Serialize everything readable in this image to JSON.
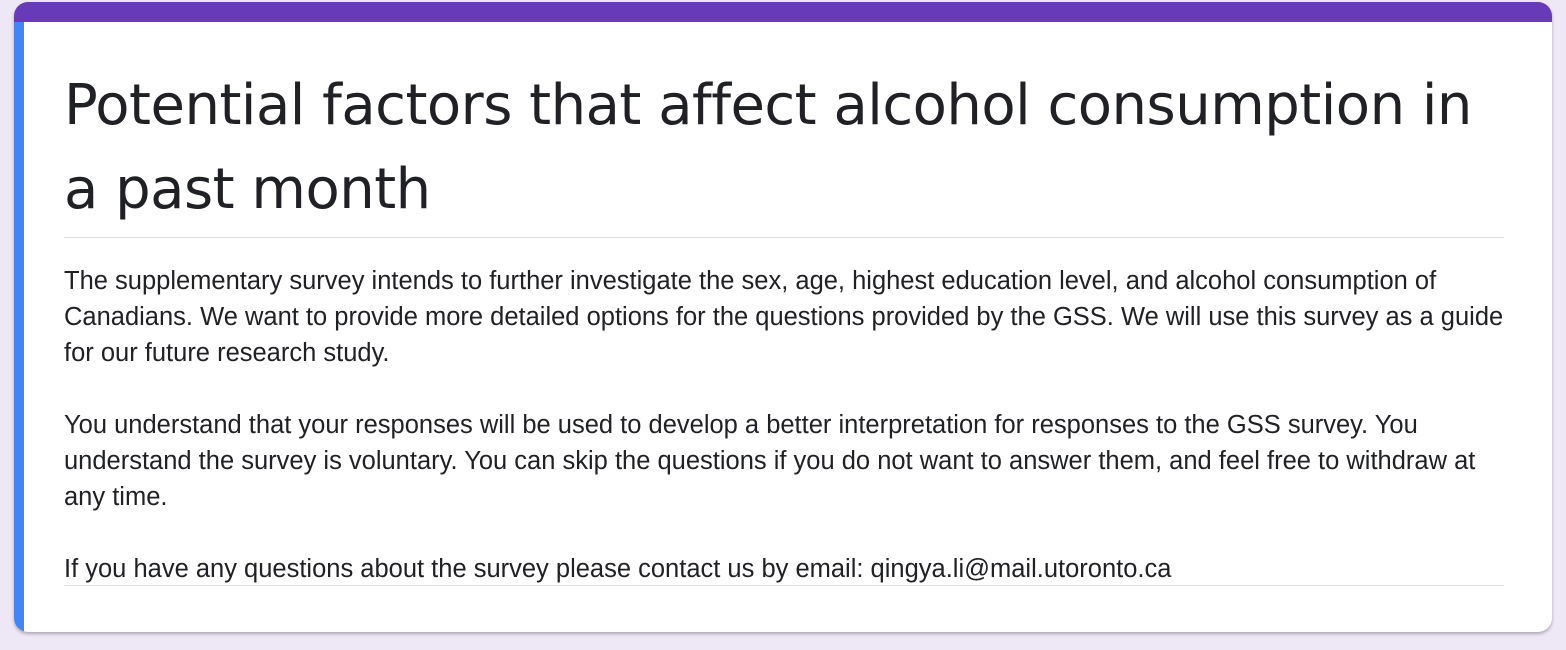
{
  "form": {
    "title": "Potential factors that affect alcohol consumption in a past month",
    "description": {
      "paragraph_1": "The supplementary survey intends to further investigate the sex, age, highest education level, and alcohol consumption of Canadians. We want to provide more detailed options for the questions provided by the GSS. We will use this survey as a guide for our future research study.",
      "paragraph_2": "You understand that your responses will be used to develop a better interpretation for responses to the GSS survey. You understand the survey is voluntary. You can skip the questions if you do not want to answer them, and feel free to withdraw at any time.",
      "paragraph_3": "If you have any questions about the survey please contact us by email: qingya.li@mail.utoronto.ca"
    }
  },
  "colors": {
    "page_background": "#ede7f6",
    "card_background": "#ffffff",
    "theme_accent": "#673ab7",
    "focus_accent": "#4285f4",
    "text": "#202124",
    "divider": "#dadce0"
  }
}
